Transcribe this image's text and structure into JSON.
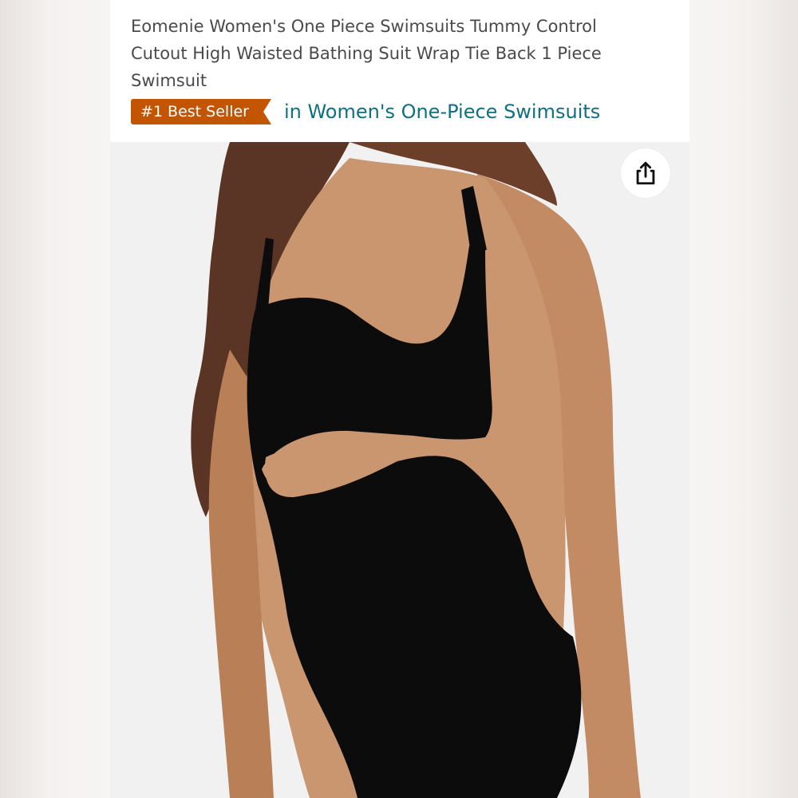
{
  "product": {
    "title": "Eomenie Women's One Piece Swimsuits Tummy Control Cutout High Waisted Bathing Suit Wrap Tie Back 1 Piece Swimsuit",
    "badge_label": "#1 Best Seller",
    "badge_category": "in Women's One-Piece Swimsuits"
  },
  "image": {
    "subject": "model-wearing-black-cutout-one-piece-swimsuit",
    "background_color": "#f1f1f1"
  },
  "actions": {
    "share_icon": "share-icon"
  },
  "colors": {
    "badge": "#c45500",
    "category_link": "#0f6f83",
    "title_text": "#4a4a4a",
    "swimsuit": "#0c0c0c",
    "skin": "#c4906a",
    "hair": "#5a3424"
  }
}
